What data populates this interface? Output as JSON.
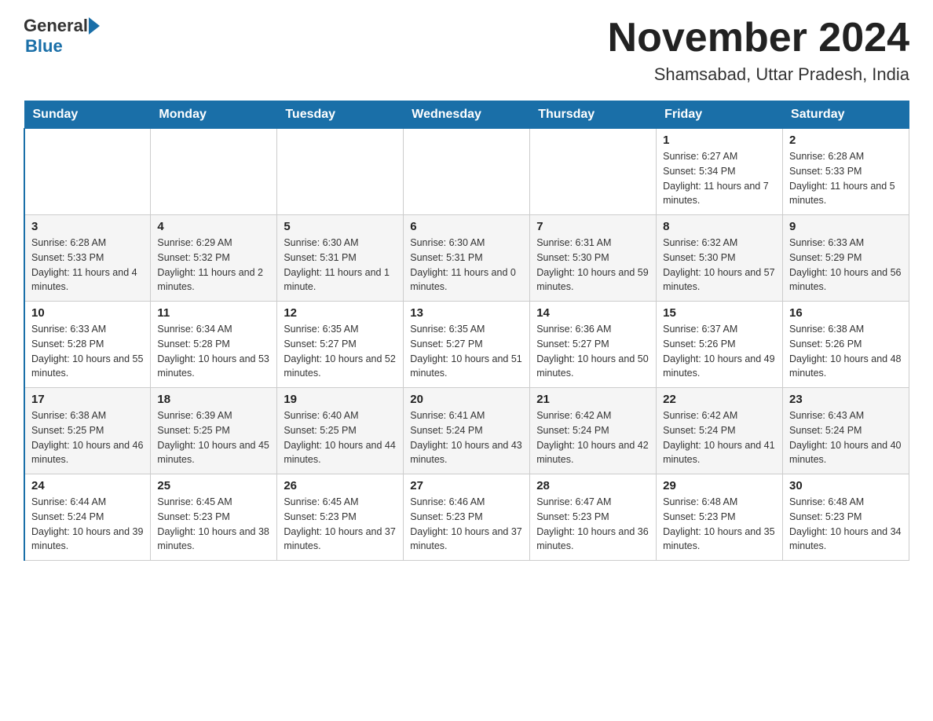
{
  "header": {
    "logo_general": "General",
    "logo_blue": "Blue",
    "title": "November 2024",
    "location": "Shamsabad, Uttar Pradesh, India"
  },
  "calendar": {
    "days_of_week": [
      "Sunday",
      "Monday",
      "Tuesday",
      "Wednesday",
      "Thursday",
      "Friday",
      "Saturday"
    ],
    "weeks": [
      [
        {
          "day": "",
          "info": ""
        },
        {
          "day": "",
          "info": ""
        },
        {
          "day": "",
          "info": ""
        },
        {
          "day": "",
          "info": ""
        },
        {
          "day": "",
          "info": ""
        },
        {
          "day": "1",
          "info": "Sunrise: 6:27 AM\nSunset: 5:34 PM\nDaylight: 11 hours and 7 minutes."
        },
        {
          "day": "2",
          "info": "Sunrise: 6:28 AM\nSunset: 5:33 PM\nDaylight: 11 hours and 5 minutes."
        }
      ],
      [
        {
          "day": "3",
          "info": "Sunrise: 6:28 AM\nSunset: 5:33 PM\nDaylight: 11 hours and 4 minutes."
        },
        {
          "day": "4",
          "info": "Sunrise: 6:29 AM\nSunset: 5:32 PM\nDaylight: 11 hours and 2 minutes."
        },
        {
          "day": "5",
          "info": "Sunrise: 6:30 AM\nSunset: 5:31 PM\nDaylight: 11 hours and 1 minute."
        },
        {
          "day": "6",
          "info": "Sunrise: 6:30 AM\nSunset: 5:31 PM\nDaylight: 11 hours and 0 minutes."
        },
        {
          "day": "7",
          "info": "Sunrise: 6:31 AM\nSunset: 5:30 PM\nDaylight: 10 hours and 59 minutes."
        },
        {
          "day": "8",
          "info": "Sunrise: 6:32 AM\nSunset: 5:30 PM\nDaylight: 10 hours and 57 minutes."
        },
        {
          "day": "9",
          "info": "Sunrise: 6:33 AM\nSunset: 5:29 PM\nDaylight: 10 hours and 56 minutes."
        }
      ],
      [
        {
          "day": "10",
          "info": "Sunrise: 6:33 AM\nSunset: 5:28 PM\nDaylight: 10 hours and 55 minutes."
        },
        {
          "day": "11",
          "info": "Sunrise: 6:34 AM\nSunset: 5:28 PM\nDaylight: 10 hours and 53 minutes."
        },
        {
          "day": "12",
          "info": "Sunrise: 6:35 AM\nSunset: 5:27 PM\nDaylight: 10 hours and 52 minutes."
        },
        {
          "day": "13",
          "info": "Sunrise: 6:35 AM\nSunset: 5:27 PM\nDaylight: 10 hours and 51 minutes."
        },
        {
          "day": "14",
          "info": "Sunrise: 6:36 AM\nSunset: 5:27 PM\nDaylight: 10 hours and 50 minutes."
        },
        {
          "day": "15",
          "info": "Sunrise: 6:37 AM\nSunset: 5:26 PM\nDaylight: 10 hours and 49 minutes."
        },
        {
          "day": "16",
          "info": "Sunrise: 6:38 AM\nSunset: 5:26 PM\nDaylight: 10 hours and 48 minutes."
        }
      ],
      [
        {
          "day": "17",
          "info": "Sunrise: 6:38 AM\nSunset: 5:25 PM\nDaylight: 10 hours and 46 minutes."
        },
        {
          "day": "18",
          "info": "Sunrise: 6:39 AM\nSunset: 5:25 PM\nDaylight: 10 hours and 45 minutes."
        },
        {
          "day": "19",
          "info": "Sunrise: 6:40 AM\nSunset: 5:25 PM\nDaylight: 10 hours and 44 minutes."
        },
        {
          "day": "20",
          "info": "Sunrise: 6:41 AM\nSunset: 5:24 PM\nDaylight: 10 hours and 43 minutes."
        },
        {
          "day": "21",
          "info": "Sunrise: 6:42 AM\nSunset: 5:24 PM\nDaylight: 10 hours and 42 minutes."
        },
        {
          "day": "22",
          "info": "Sunrise: 6:42 AM\nSunset: 5:24 PM\nDaylight: 10 hours and 41 minutes."
        },
        {
          "day": "23",
          "info": "Sunrise: 6:43 AM\nSunset: 5:24 PM\nDaylight: 10 hours and 40 minutes."
        }
      ],
      [
        {
          "day": "24",
          "info": "Sunrise: 6:44 AM\nSunset: 5:24 PM\nDaylight: 10 hours and 39 minutes."
        },
        {
          "day": "25",
          "info": "Sunrise: 6:45 AM\nSunset: 5:23 PM\nDaylight: 10 hours and 38 minutes."
        },
        {
          "day": "26",
          "info": "Sunrise: 6:45 AM\nSunset: 5:23 PM\nDaylight: 10 hours and 37 minutes."
        },
        {
          "day": "27",
          "info": "Sunrise: 6:46 AM\nSunset: 5:23 PM\nDaylight: 10 hours and 37 minutes."
        },
        {
          "day": "28",
          "info": "Sunrise: 6:47 AM\nSunset: 5:23 PM\nDaylight: 10 hours and 36 minutes."
        },
        {
          "day": "29",
          "info": "Sunrise: 6:48 AM\nSunset: 5:23 PM\nDaylight: 10 hours and 35 minutes."
        },
        {
          "day": "30",
          "info": "Sunrise: 6:48 AM\nSunset: 5:23 PM\nDaylight: 10 hours and 34 minutes."
        }
      ]
    ]
  }
}
